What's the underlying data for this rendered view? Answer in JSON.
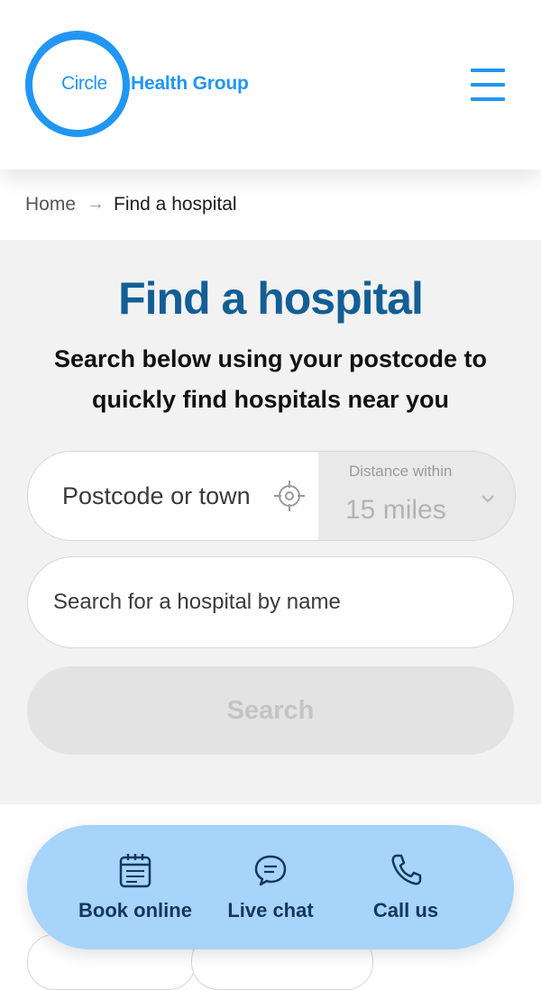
{
  "header": {
    "logo": {
      "word1": "Circle",
      "word2": "Health Group"
    },
    "menu_icon": "hamburger-menu-icon"
  },
  "breadcrumb": {
    "home": "Home",
    "separator": "→",
    "current": "Find a hospital"
  },
  "search": {
    "title": "Find a hospital",
    "subtitle": "Search below using your postcode to quickly find hospitals near you",
    "postcode_placeholder": "Postcode or town",
    "distance_label": "Distance within",
    "distance_value": "15 miles",
    "name_placeholder": "Search for a hospital by name",
    "search_button": "Search"
  },
  "actions": [
    {
      "label": "Book online",
      "icon": "calendar-icon"
    },
    {
      "label": "Live chat",
      "icon": "chat-bubble-icon"
    },
    {
      "label": "Call us",
      "icon": "phone-icon"
    }
  ],
  "colors": {
    "brand_blue": "#2196f3",
    "title_blue": "#135f95",
    "panel_gray": "#f2f2f2",
    "action_bar": "#a6d4fa",
    "action_text": "#14365c"
  }
}
